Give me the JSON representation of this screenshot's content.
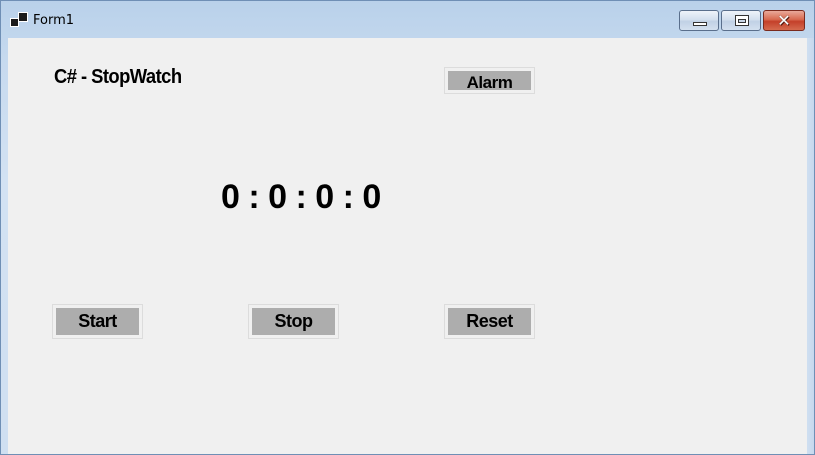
{
  "window": {
    "title": "Form1",
    "icon": "app-window-icon",
    "minimize_icon": "minimize-icon",
    "maximize_icon": "maximize-icon",
    "close_icon": "close-icon",
    "close_glyph": "✕"
  },
  "form": {
    "heading": "C# - StopWatch",
    "time_display": "0 : 0 : 0 : 0",
    "buttons": {
      "alarm": "Alarm",
      "start": "Start",
      "stop": "Stop",
      "reset": "Reset"
    }
  },
  "colors": {
    "client_background": "#f0f0f0",
    "button_face": "#adadad",
    "close_button": "#c4402a"
  }
}
